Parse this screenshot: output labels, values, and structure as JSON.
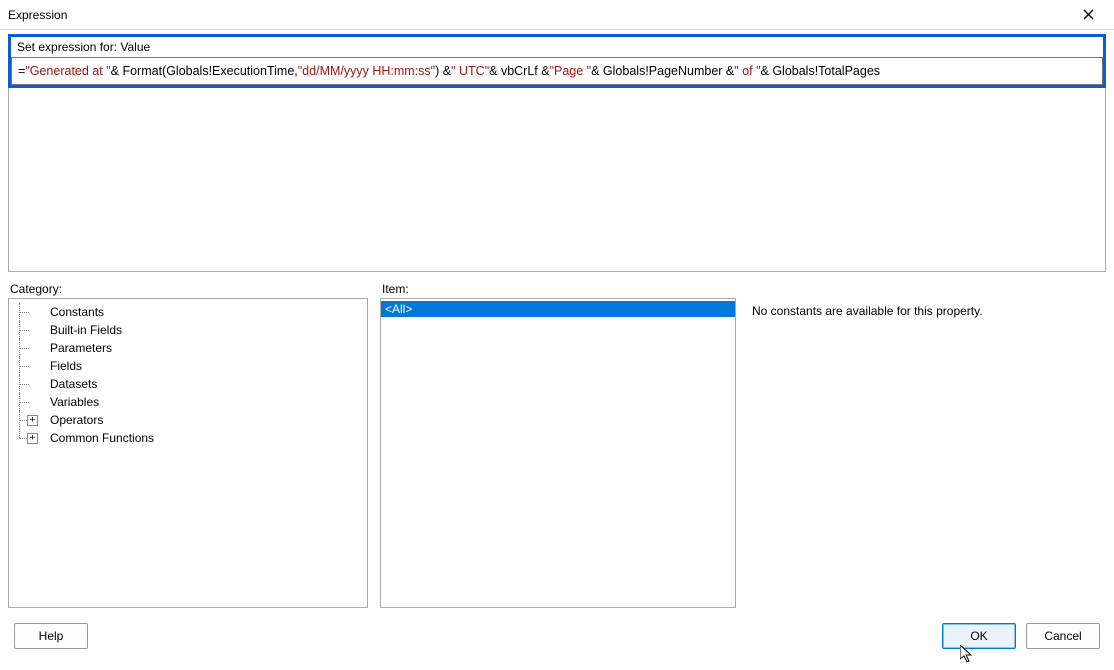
{
  "window": {
    "title": "Expression"
  },
  "expression": {
    "label": "Set expression for: Value",
    "tokens": [
      {
        "t": "=",
        "c": "kw"
      },
      {
        "t": "\"Generated at \"",
        "c": "str"
      },
      {
        "t": " & Format(Globals!ExecutionTime, ",
        "c": "kw"
      },
      {
        "t": "\"dd/MM/yyyy HH:mm:ss\"",
        "c": "str"
      },
      {
        "t": ") & ",
        "c": "kw"
      },
      {
        "t": "\" UTC\"",
        "c": "str"
      },
      {
        "t": " & vbCrLf & ",
        "c": "kw"
      },
      {
        "t": "\"Page \"",
        "c": "str"
      },
      {
        "t": " & Globals!PageNumber & ",
        "c": "kw"
      },
      {
        "t": "\" of \"",
        "c": "str"
      },
      {
        "t": " & Globals!TotalPages",
        "c": "kw"
      }
    ]
  },
  "category": {
    "label": "Category:",
    "items": [
      {
        "label": "Constants",
        "expandable": false
      },
      {
        "label": "Built-in Fields",
        "expandable": false
      },
      {
        "label": "Parameters",
        "expandable": false
      },
      {
        "label": "Fields",
        "expandable": false
      },
      {
        "label": "Datasets",
        "expandable": false
      },
      {
        "label": "Variables",
        "expandable": false
      },
      {
        "label": "Operators",
        "expandable": true
      },
      {
        "label": "Common Functions",
        "expandable": true
      }
    ]
  },
  "item": {
    "label": "Item:",
    "entries": [
      {
        "label": "<All>",
        "selected": true
      }
    ]
  },
  "description": {
    "text": "No constants are available for this property."
  },
  "buttons": {
    "help": "Help",
    "ok": "OK",
    "cancel": "Cancel"
  }
}
